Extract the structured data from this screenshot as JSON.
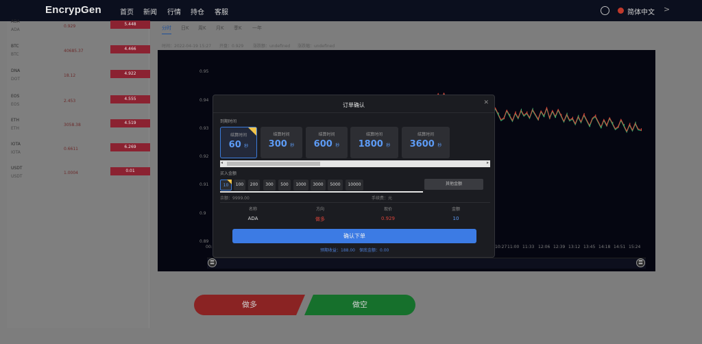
{
  "nav": {
    "logo": "EncrypGen",
    "items": [
      "首页",
      "新闻",
      "行情",
      "持仓",
      "客服"
    ],
    "language": "简体中文",
    "next_arrow": ">",
    "icons": [
      "user-icon",
      "flag-icon",
      "chevron-right-icon"
    ]
  },
  "coins": [
    {
      "name": "ADA",
      "code": "ADA",
      "price": "0.929",
      "change": "5.448"
    },
    {
      "name": "BTC",
      "code": "BTC",
      "price": "40685.37",
      "change": "4.466"
    },
    {
      "name": "DNA",
      "code": "DOT",
      "price": "18.12",
      "change": "4.922"
    },
    {
      "name": "EOS",
      "code": "EOS",
      "price": "2.453",
      "change": "4.555"
    },
    {
      "name": "ETH",
      "code": "ETH",
      "price": "3058.38",
      "change": "4.519"
    },
    {
      "name": "IOTA",
      "code": "IOTA",
      "price": "0.6611",
      "change": "6.269"
    },
    {
      "name": "USDT",
      "code": "USDT",
      "price": "1.0004",
      "change": "0.01"
    }
  ],
  "chart_tabs": [
    "分时",
    "日K",
    "周K",
    "月K",
    "季K",
    "一年"
  ],
  "chart_info": {
    "time": "时间：2022-04-19 15:27",
    "open": "开盘：0.929",
    "up": "涨跌额：undefined",
    "pct": "涨跌幅：undefined"
  },
  "chart_data": {
    "type": "line",
    "y_ticks": [
      "0.95",
      "0.94",
      "0.93",
      "0.92",
      "0.91",
      "0.9",
      "0.89"
    ],
    "ylim": [
      0.89,
      0.95
    ],
    "x_first_tick": "00:",
    "x_ticks": [
      "10:27",
      "11:00",
      "11:33",
      "12:06",
      "12:39",
      "13:12",
      "13:45",
      "14:18",
      "14:51",
      "15:24"
    ],
    "visible_segment_x": [
      "10:27",
      "11:00",
      "11:33",
      "12:06",
      "12:39",
      "13:12",
      "13:45",
      "14:18",
      "14:51",
      "15:24"
    ],
    "visible_segment_y": [
      0.941,
      0.938,
      0.936,
      0.934,
      0.934,
      0.935,
      0.933,
      0.932,
      0.931,
      0.929
    ],
    "series_color": "#d7473a",
    "ma_color": "#2fae6b",
    "grid": false
  },
  "slider": {
    "left_handle": "〓",
    "right_handle": "〓"
  },
  "actions": {
    "long": "做多",
    "short": "做空"
  },
  "modal": {
    "title": "订单确认",
    "close": "✕",
    "expiry_label": "到期时间",
    "time_options": [
      {
        "label": "结算时间",
        "seconds": "60",
        "unit": "秒",
        "selected": true
      },
      {
        "label": "结算时间",
        "seconds": "300",
        "unit": "秒",
        "selected": false
      },
      {
        "label": "结算时间",
        "seconds": "600",
        "unit": "秒",
        "selected": false
      },
      {
        "label": "结算时间",
        "seconds": "1800",
        "unit": "秒",
        "selected": false
      },
      {
        "label": "结算时间",
        "seconds": "3600",
        "unit": "秒",
        "selected": false
      }
    ],
    "scroll_left": "◂",
    "scroll_right": "▸",
    "amount_label": "买入金额",
    "amounts": [
      "10",
      "100",
      "200",
      "300",
      "500",
      "1000",
      "3000",
      "5000",
      "10000"
    ],
    "selected_amount": "10",
    "other_amount": "其他金额",
    "balance": "余额：9999.00",
    "fee": "手续费：元",
    "table_headers": [
      "名称",
      "方向",
      "现价",
      "金额"
    ],
    "table_row": {
      "name": "ADA",
      "direction": "做多",
      "price": "0.929",
      "amount": "10"
    },
    "confirm": "确认下单",
    "expected_profit": "预期收益：188.00",
    "guarantee": "保底金额：0.00"
  }
}
